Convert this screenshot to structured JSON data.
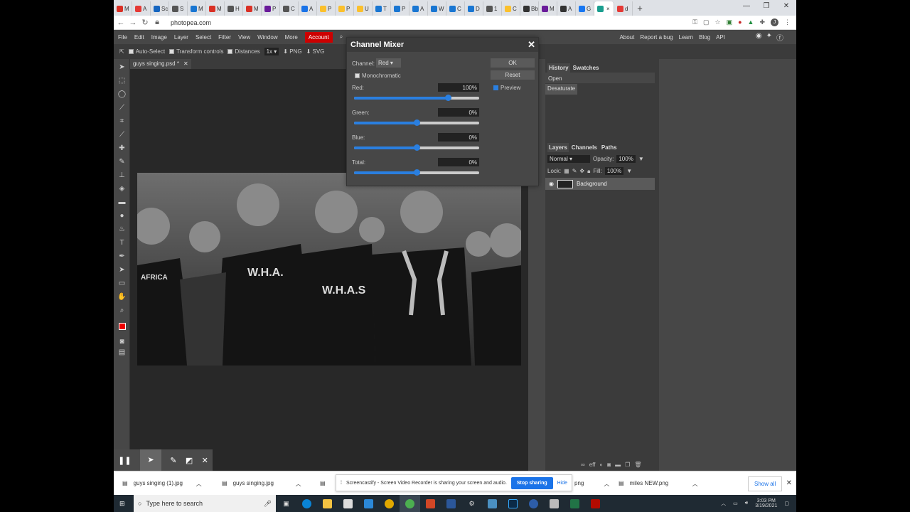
{
  "browser": {
    "tabs": [
      {
        "label": "M",
        "color": "#d93025"
      },
      {
        "label": "A",
        "color": "#e53935"
      },
      {
        "label": "Sc",
        "color": "#1565c0"
      },
      {
        "label": "S",
        "color": "#555"
      },
      {
        "label": "M",
        "color": "#1976d2"
      },
      {
        "label": "M",
        "color": "#d93025"
      },
      {
        "label": "H",
        "color": "#555"
      },
      {
        "label": "M",
        "color": "#d93025"
      },
      {
        "label": "P",
        "color": "#6a1b9a"
      },
      {
        "label": "C",
        "color": "#555"
      },
      {
        "label": "A",
        "color": "#1a73e8"
      },
      {
        "label": "P",
        "color": "#fbc02d"
      },
      {
        "label": "P",
        "color": "#fbc02d"
      },
      {
        "label": "U",
        "color": "#fbc02d"
      },
      {
        "label": "T",
        "color": "#1976d2"
      },
      {
        "label": "P",
        "color": "#1976d2"
      },
      {
        "label": "A",
        "color": "#1976d2"
      },
      {
        "label": "W",
        "color": "#1976d2"
      },
      {
        "label": "C",
        "color": "#1976d2"
      },
      {
        "label": "D",
        "color": "#1976d2"
      },
      {
        "label": "1",
        "color": "#555"
      },
      {
        "label": "C",
        "color": "#fbc02d"
      },
      {
        "label": "Bb",
        "color": "#333"
      },
      {
        "label": "M",
        "color": "#6a1b9a"
      },
      {
        "label": "A",
        "color": "#333"
      },
      {
        "label": "G",
        "color": "#1877f2"
      },
      {
        "label": "",
        "color": "#1a9e8f",
        "active": true
      },
      {
        "label": "d",
        "color": "#e53935"
      }
    ],
    "new_tab": "+",
    "url": "photopea.com"
  },
  "app": {
    "menu": [
      "File",
      "Edit",
      "Image",
      "Layer",
      "Select",
      "Filter",
      "View",
      "Window",
      "More"
    ],
    "account": "Account",
    "right_links": [
      "About",
      "Report a bug",
      "Learn",
      "Blog",
      "API"
    ],
    "options": {
      "auto_select": "Auto-Select",
      "transform_controls": "Transform controls",
      "distances": "Distances",
      "zoom": "1x",
      "png": "PNG",
      "svg": "SVG"
    },
    "doc_tab": "guys singing.psd *",
    "doc_close": "✕"
  },
  "history": {
    "tabs": [
      "History",
      "Swatches"
    ],
    "items": [
      "Open",
      "Desaturate"
    ]
  },
  "layers": {
    "tabs": [
      "Layers",
      "Channels",
      "Paths"
    ],
    "blend": "Normal",
    "opacity_label": "Opacity:",
    "opacity": "100%",
    "lock_label": "Lock:",
    "fill_label": "Fill:",
    "fill": "100%",
    "layer_name": "Background",
    "bottom_icons": [
      "eff"
    ]
  },
  "dialog": {
    "title": "Channel Mixer",
    "channel_label": "Channel:",
    "channel_value": "Red",
    "monochromatic": "Monochromatic",
    "ok": "OK",
    "reset": "Reset",
    "preview": "Preview",
    "sliders": [
      {
        "label": "Red:",
        "value": "100%",
        "level": 0.75
      },
      {
        "label": "Green:",
        "value": "0%",
        "level": 0.5
      },
      {
        "label": "Blue:",
        "value": "0%",
        "level": 0.5
      },
      {
        "label": "Total:",
        "value": "0%",
        "level": 0.5
      }
    ]
  },
  "downloads": {
    "items": [
      "guys singing (1).jpg",
      "guys singing.jpg",
      "miles NEW.png"
    ],
    "partial": "png",
    "notice": "Screencastify - Screen Video Recorder is sharing your screen and audio.",
    "stop": "Stop sharing",
    "hide": "Hide",
    "show_all": "Show all"
  },
  "taskbar": {
    "search_placeholder": "Type here to search",
    "time": "3:03 PM",
    "date": "3/19/2021"
  }
}
